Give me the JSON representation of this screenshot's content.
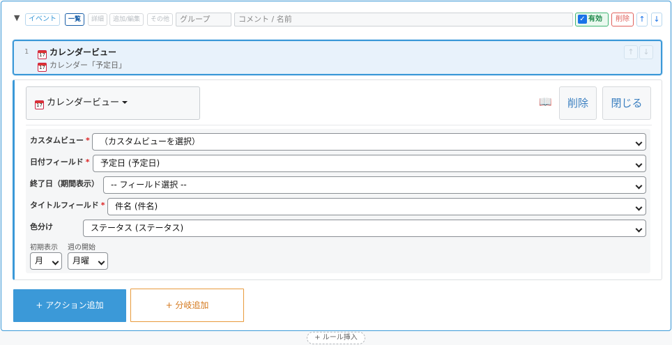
{
  "header": {
    "collapse_glyph": "▼",
    "event_chip": "イベント",
    "view_chips": [
      "一覧",
      "詳細",
      "追加/編集",
      "その他"
    ],
    "group_placeholder": "グループ",
    "comment_placeholder": "コメント / 名前",
    "enabled_label": "有効",
    "enabled_checked": true,
    "delete_label": "削除",
    "up_glyph": "↑",
    "down_glyph": "↓"
  },
  "rule": {
    "number": "1",
    "title": "カレンダービュー",
    "subtitle": "カレンダー「予定日」",
    "up_glyph": "↑",
    "down_glyph": "↓",
    "icon": "calendar-icon",
    "icon_day": "17"
  },
  "editor": {
    "action_type": "カレンダービュー",
    "help_icon": "📖",
    "delete_label": "削除",
    "close_label": "閉じる",
    "fields": [
      {
        "label": "カスタムビュー",
        "required": "*",
        "value": "（カスタムビューを選択）"
      },
      {
        "label": "日付フィールド",
        "required": "*",
        "value": "予定日 (予定日)"
      },
      {
        "label": "終了日（期間表示）",
        "required": "",
        "value": "-- フィールド選択 --"
      },
      {
        "label": "タイトルフィールド",
        "required": "*",
        "value": "件名 (件名)"
      },
      {
        "label": "色分け",
        "required": "",
        "value": "ステータス (ステータス)"
      }
    ],
    "initial_view_label": "初期表示",
    "initial_view_value": "月",
    "week_start_label": "週の開始",
    "week_start_value": "月曜"
  },
  "buttons": {
    "add_action": "+ アクション追加",
    "add_branch": "+ 分岐追加",
    "insert_rule": "+ ルール挿入"
  },
  "colors": {
    "accent": "#3b99d8",
    "enabled": "#3cb371",
    "danger": "#e0605b",
    "branch": "#e89a3c"
  }
}
